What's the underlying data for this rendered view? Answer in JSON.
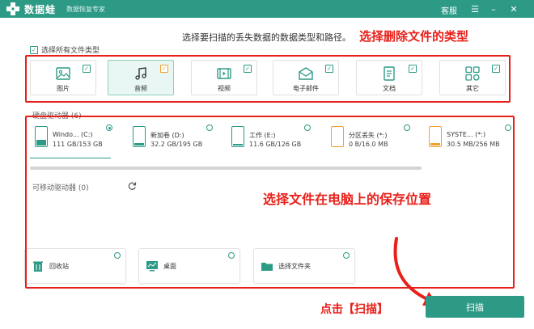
{
  "titlebar": {
    "app_name": "数据蛙",
    "subtitle": "数据恢复专家",
    "support": "客服",
    "bg_color": "#2d9a86"
  },
  "instruction": "选择要扫描的丢失数据的数据类型和路径。",
  "annotations": {
    "types": "选择删除文件的类型",
    "location": "选择文件在电脑上的保存位置",
    "click_scan": "点击【扫描】",
    "color": "#e8201a"
  },
  "select_all": {
    "label": "选择所有文件类型",
    "checked": true
  },
  "file_types": [
    {
      "label": "图片",
      "icon": "image-icon",
      "checked": true,
      "selected": false
    },
    {
      "label": "音频",
      "icon": "music-icon",
      "checked": true,
      "selected": true
    },
    {
      "label": "视频",
      "icon": "video-icon",
      "checked": true,
      "selected": false
    },
    {
      "label": "电子邮件",
      "icon": "email-icon",
      "checked": true,
      "selected": false
    },
    {
      "label": "文档",
      "icon": "document-icon",
      "checked": true,
      "selected": false
    },
    {
      "label": "其它",
      "icon": "other-icon",
      "checked": true,
      "selected": false
    }
  ],
  "hard_drives": {
    "label": "硬盘驱动器 (6)",
    "items": [
      {
        "name": "Windo... (C:)",
        "size": "111 GB/153 GB",
        "fill": 0.72,
        "color": "teal",
        "selected": true
      },
      {
        "name": "新加卷 (D:)",
        "size": "32.2 GB/195 GB",
        "fill": 0.17,
        "color": "teal",
        "selected": false
      },
      {
        "name": "工作 (E:)",
        "size": "11.6 GB/126 GB",
        "fill": 0.09,
        "color": "teal",
        "selected": false
      },
      {
        "name": "分区丢失 (*:)",
        "size": "0 B/16.0 MB",
        "fill": 0.0,
        "color": "orange",
        "selected": false
      },
      {
        "name": "SYSTE... (*:)",
        "size": "30.5 MB/256 MB",
        "fill": 0.12,
        "color": "orange",
        "selected": false
      }
    ]
  },
  "removable_drives": {
    "label": "可移动驱动器 (0)"
  },
  "locations": [
    {
      "label": "回收站",
      "icon": "recycle-bin-icon"
    },
    {
      "label": "桌面",
      "icon": "desktop-icon"
    },
    {
      "label": "选择文件夹",
      "icon": "folder-icon"
    }
  ],
  "scan_button": "扫描"
}
